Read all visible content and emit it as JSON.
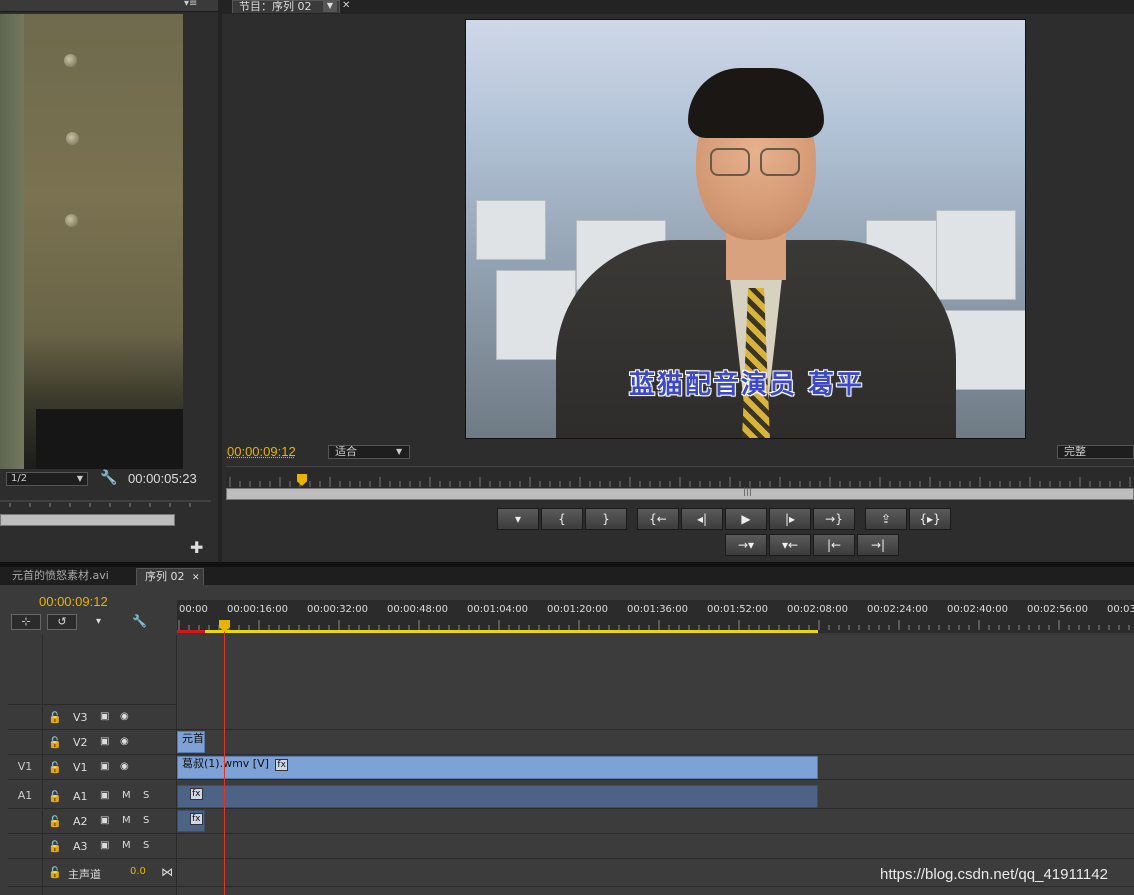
{
  "source_monitor": {
    "zoom": "1/2",
    "timecode": "00:00:05:23"
  },
  "program_monitor": {
    "tab_label": "节目：序列 02",
    "subtitle": "蓝猫配音演员  葛平",
    "timecode": "00:00:09:12",
    "fit": "适合",
    "quality": "完整",
    "transport": {
      "add_marker": "▾",
      "mark_in": "{",
      "mark_out": "}",
      "go_to_in": "{←",
      "step_back": "◂|",
      "play": "▶",
      "step_forward": "|▸",
      "go_to_out": "→}",
      "export_frame": "⇪",
      "play_in_to_out": "{▸}",
      "go_prev_marker": "→▾",
      "go_next_marker": "▾←",
      "go_prev_edit": "|←",
      "go_next_edit": "→|"
    }
  },
  "timeline": {
    "tabs": [
      {
        "label": "元首的愤怒素材.avi"
      },
      {
        "label": "序列 02"
      }
    ],
    "timecode": "00:00:09:12",
    "ruler_labels": [
      "00:00",
      "00:00:16:00",
      "00:00:32:00",
      "00:00:48:00",
      "00:01:04:00",
      "00:01:20:00",
      "00:01:36:00",
      "00:01:52:00",
      "00:02:08:00",
      "00:02:24:00",
      "00:02:40:00",
      "00:02:56:00",
      "00:03"
    ],
    "tracks": {
      "v3": "V3",
      "v2": "V2",
      "v1": "V1",
      "v1_source": "V1",
      "a1": "A1",
      "a1_source": "A1",
      "a2": "A2",
      "a3": "A3",
      "master": "主声道",
      "master_level": "0.0",
      "m": "M",
      "s": "S"
    },
    "clips": {
      "v2_clip": "元首",
      "v1_clip": "葛叔(1).wmv [V]",
      "fx": "fx"
    }
  },
  "watermark": "https://blog.csdn.net/qq_41911142"
}
